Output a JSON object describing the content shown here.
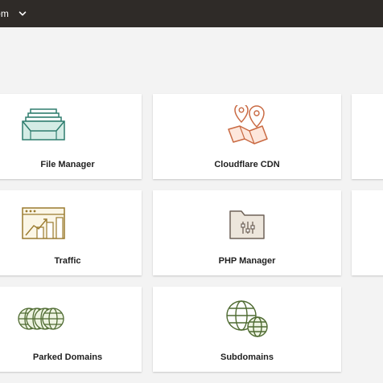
{
  "header": {
    "domain_text": "om"
  },
  "tools": [
    {
      "label": "File Manager",
      "icon": "file-manager-icon"
    },
    {
      "label": "Cloudflare CDN",
      "icon": "cloudflare-map-pin-icon"
    },
    {
      "label": "Traffic",
      "icon": "traffic-chart-icon"
    },
    {
      "label": "PHP Manager",
      "icon": "php-manager-folder-icon"
    },
    {
      "label": "Parked Domains",
      "icon": "parked-domains-globes-icon"
    },
    {
      "label": "Subdomains",
      "icon": "subdomains-globes-icon"
    }
  ],
  "colors": {
    "topbar": "#2f2b28",
    "background": "#f3f3f3",
    "card": "#ffffff"
  }
}
